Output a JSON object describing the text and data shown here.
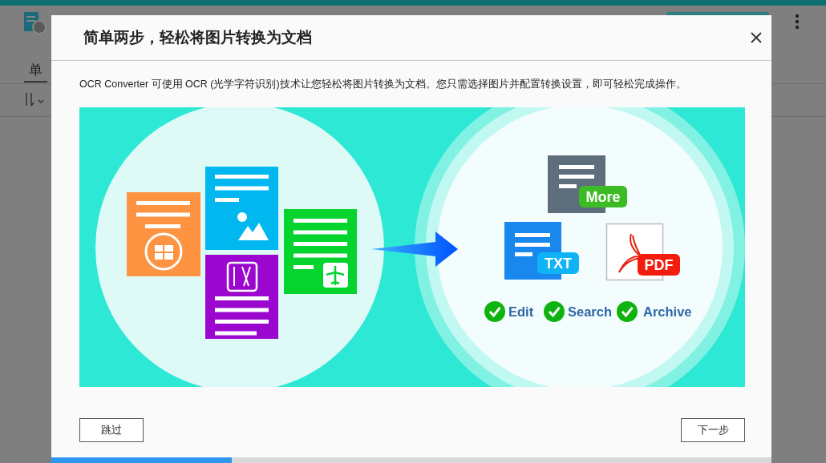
{
  "app": {
    "tab": "单"
  },
  "dialog": {
    "title": "简单两步，轻松将图片转换为文档",
    "description": "OCR Converter 可使用 OCR (光学字符识别)技术让您轻松将图片转换为文档。您只需选择图片并配置转换设置，即可轻松完成操作。",
    "illustration": {
      "formats": [
        {
          "label": "More",
          "kind": "more"
        },
        {
          "label": "TXT",
          "kind": "txt"
        },
        {
          "label": "PDF",
          "kind": "pdf"
        }
      ],
      "features": [
        "Edit",
        "Search",
        "Archive"
      ]
    },
    "buttons": [
      {
        "label": "跳过",
        "kind": "skip"
      },
      {
        "label": "下一步",
        "kind": "next"
      }
    ],
    "progress": {
      "level": 0.25
    }
  }
}
